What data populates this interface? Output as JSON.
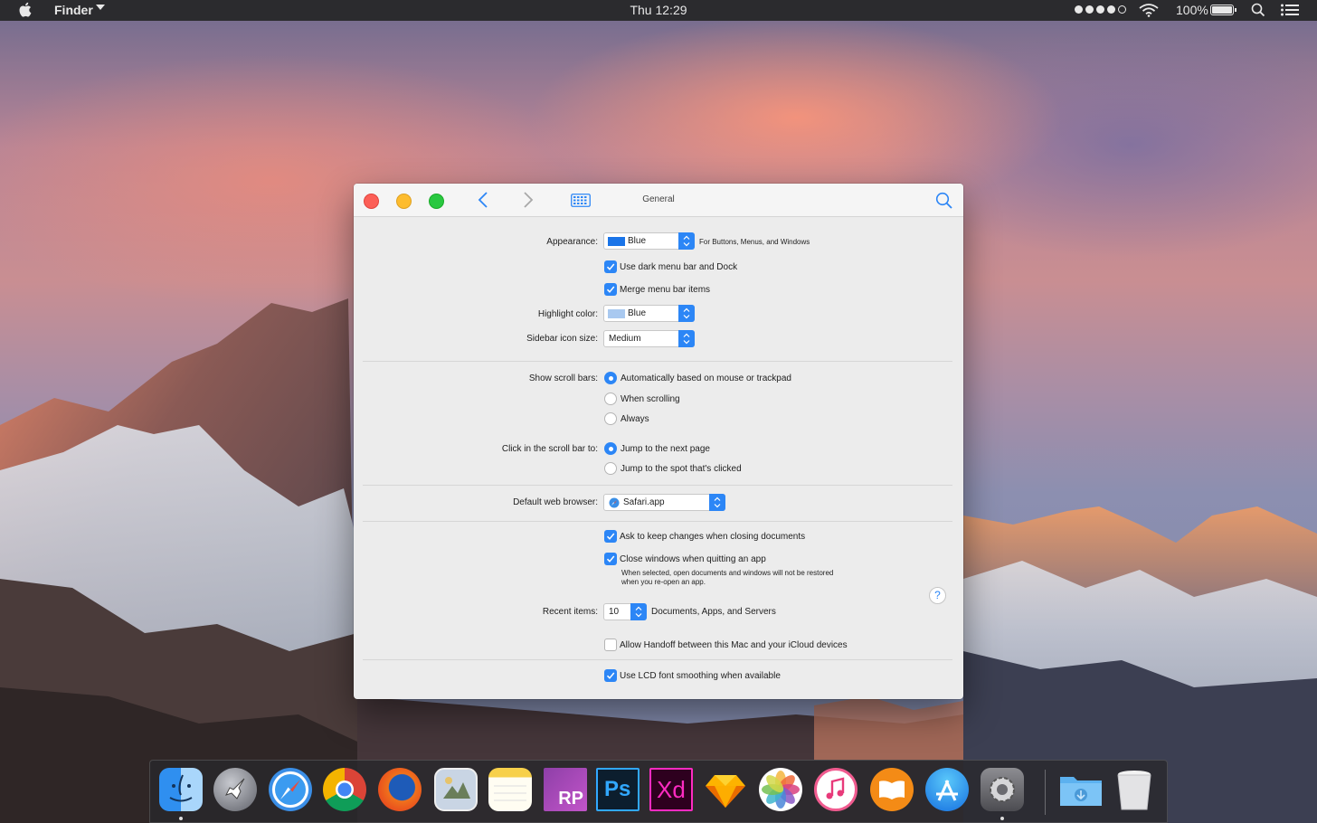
{
  "menubar": {
    "apple_glyph": "",
    "app_name": "Finder",
    "clock": "Thu 12:29",
    "battery_percent": "100%",
    "signal_bars_filled": 4,
    "signal_bars_total": 5
  },
  "window": {
    "title": "General",
    "appearance": {
      "label": "Appearance:",
      "value": "Blue",
      "swatch_color": "#1a74e8",
      "note": "For Buttons, Menus, and Windows"
    },
    "dark_menu": {
      "label": "Use dark menu bar and Dock",
      "checked": true
    },
    "merge_menu": {
      "label": "Merge menu bar items",
      "checked": true
    },
    "highlight": {
      "label": "Highlight color:",
      "value": "Blue",
      "swatch_color": "#a9c9f0"
    },
    "sidebar_size": {
      "label": "Sidebar icon size:",
      "value": "Medium"
    },
    "scroll_bars": {
      "label": "Show scroll bars:",
      "options": [
        "Automatically based on mouse or trackpad",
        "When scrolling",
        "Always"
      ],
      "selected": 0
    },
    "click_scroll": {
      "label": "Click in the scroll bar to:",
      "options": [
        "Jump to the next page",
        "Jump to the spot that's clicked"
      ],
      "selected": 0
    },
    "browser": {
      "label": "Default web browser:",
      "value": "Safari.app"
    },
    "ask_keep": {
      "label": "Ask to keep changes when closing documents",
      "checked": true
    },
    "close_windows": {
      "label": "Close windows when quitting an app",
      "checked": true,
      "note_line1": "When selected, open documents and windows will not be restored",
      "note_line2": "when you re-open an app."
    },
    "recent": {
      "label": "Recent items:",
      "value": "10",
      "suffix": "Documents, Apps, and Servers"
    },
    "handoff": {
      "label": "Allow Handoff between this Mac and your iCloud devices",
      "checked": false
    },
    "lcd": {
      "label": "Use LCD font smoothing when available",
      "checked": true
    },
    "help_glyph": "?"
  },
  "dock": {
    "items": [
      "finder-icon",
      "launchpad-icon",
      "safari-icon",
      "chrome-icon",
      "firefox-icon",
      "preview-icon",
      "notes-icon",
      "axure-icon",
      "photoshop-icon",
      "xd-icon",
      "sketch-icon",
      "photos-icon",
      "itunes-icon",
      "ibooks-icon",
      "app-store-icon",
      "system-preferences-icon",
      "downloads-folder-icon",
      "trash-icon"
    ],
    "axure_text": "RP",
    "ps_text": "Ps",
    "xd_text": "Xd"
  },
  "colors": {
    "accent": "#2c86f6",
    "close": "#fc5f57",
    "minimize": "#fdbc2e",
    "maximize": "#29c840"
  }
}
